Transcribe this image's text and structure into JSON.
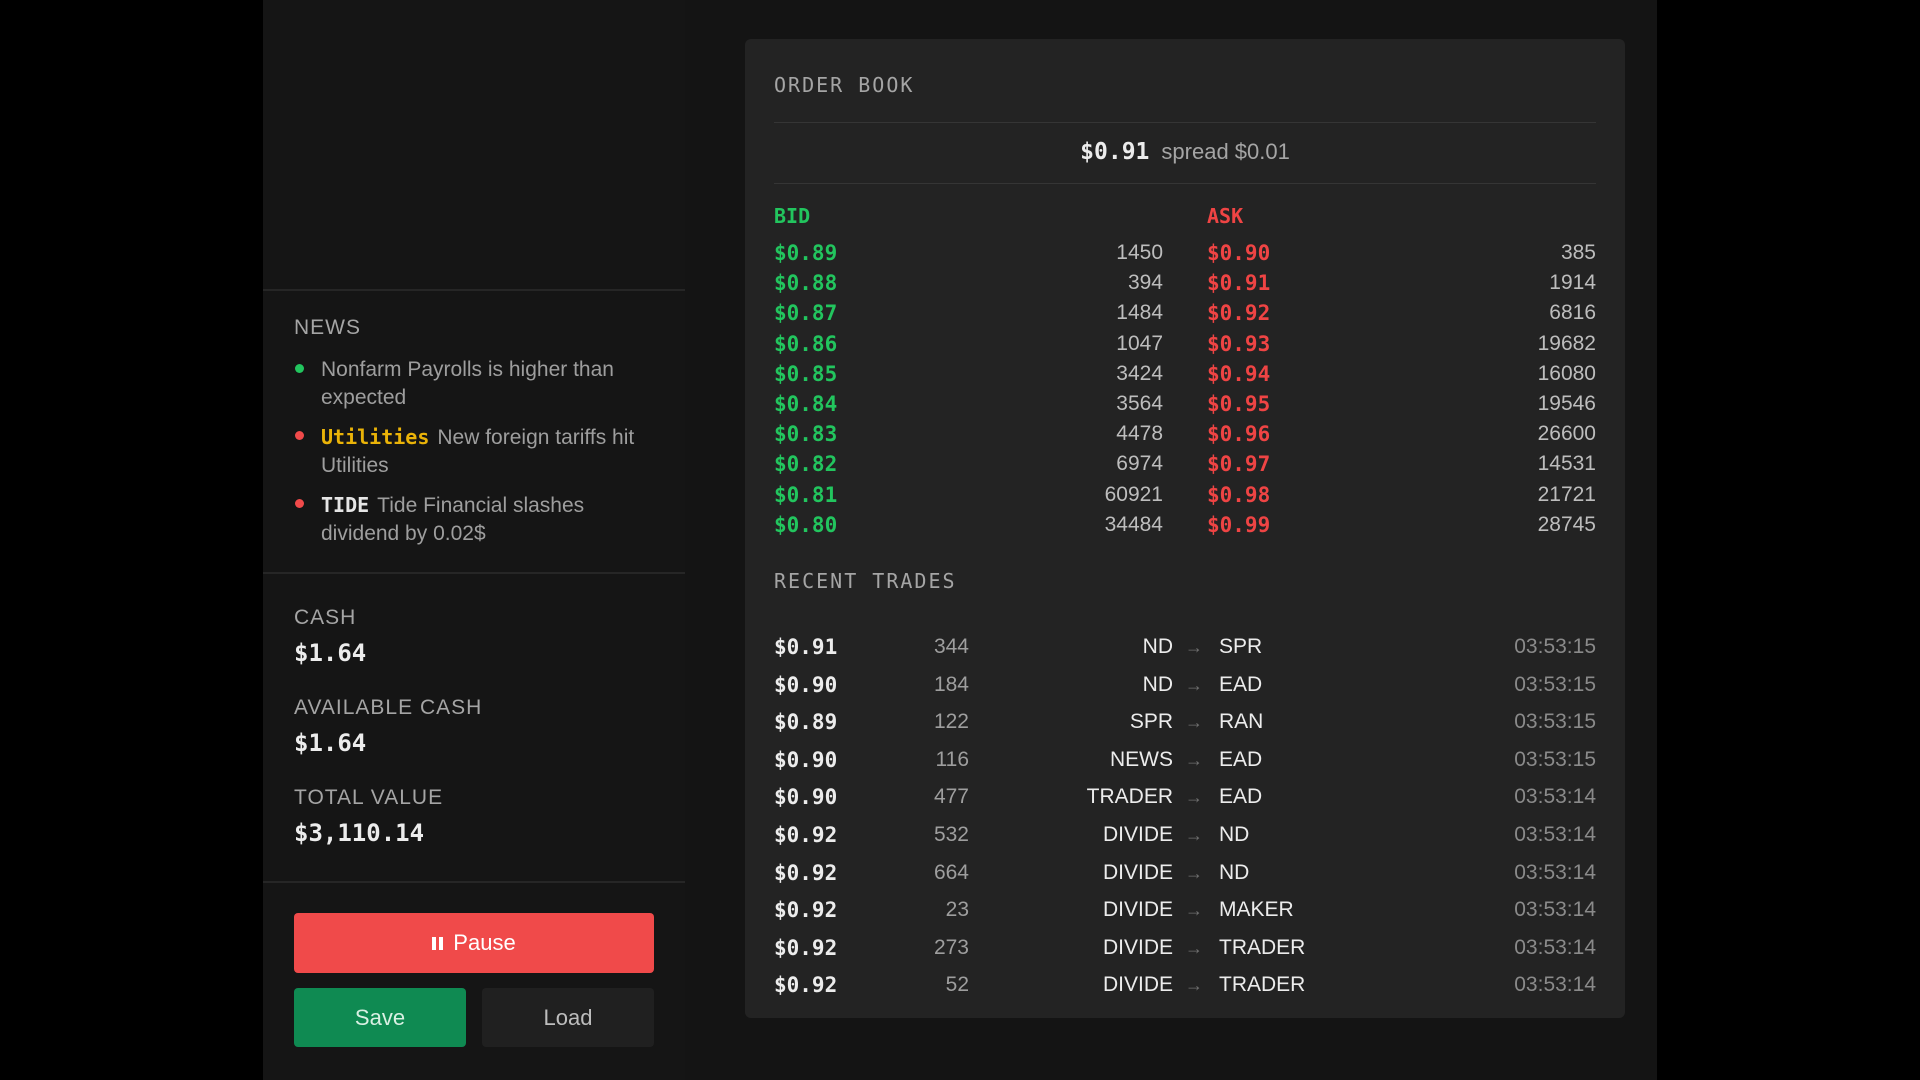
{
  "news": {
    "title": "NEWS",
    "items": [
      {
        "tag": "",
        "text": "Nonfarm Payrolls is higher than expected",
        "dot_color": "#22c55e",
        "tag_color": "#e5e5e5"
      },
      {
        "tag": "Utilities",
        "text": "New foreign tariffs hit Utilities",
        "dot_color": "#f04a4a",
        "tag_color": "#eab308"
      },
      {
        "tag": "TIDE",
        "text": "Tide Financial slashes dividend by 0.02$",
        "dot_color": "#f04a4a",
        "tag_color": "#e5e5e5"
      }
    ]
  },
  "account": {
    "cash_label": "CASH",
    "cash_value": "$1.64",
    "available_label": "AVAILABLE CASH",
    "available_value": "$1.64",
    "total_label": "TOTAL VALUE",
    "total_value": "$3,110.14"
  },
  "controls": {
    "pause_label": "Pause",
    "save_label": "Save",
    "load_label": "Load"
  },
  "order_book": {
    "title": "ORDER BOOK",
    "mid_price": "$0.91",
    "spread": "spread $0.01",
    "bid_label": "BID",
    "ask_label": "ASK",
    "bid_color": "#22c55e",
    "ask_color": "#ef4444",
    "bids": [
      {
        "price": "$0.89",
        "qty": "1450"
      },
      {
        "price": "$0.88",
        "qty": "394"
      },
      {
        "price": "$0.87",
        "qty": "1484"
      },
      {
        "price": "$0.86",
        "qty": "1047"
      },
      {
        "price": "$0.85",
        "qty": "3424"
      },
      {
        "price": "$0.84",
        "qty": "3564"
      },
      {
        "price": "$0.83",
        "qty": "4478"
      },
      {
        "price": "$0.82",
        "qty": "6974"
      },
      {
        "price": "$0.81",
        "qty": "60921"
      },
      {
        "price": "$0.80",
        "qty": "34484"
      }
    ],
    "asks": [
      {
        "price": "$0.90",
        "qty": "385"
      },
      {
        "price": "$0.91",
        "qty": "1914"
      },
      {
        "price": "$0.92",
        "qty": "6816"
      },
      {
        "price": "$0.93",
        "qty": "19682"
      },
      {
        "price": "$0.94",
        "qty": "16080"
      },
      {
        "price": "$0.95",
        "qty": "19546"
      },
      {
        "price": "$0.96",
        "qty": "26600"
      },
      {
        "price": "$0.97",
        "qty": "14531"
      },
      {
        "price": "$0.98",
        "qty": "21721"
      },
      {
        "price": "$0.99",
        "qty": "28745"
      }
    ]
  },
  "recent_trades": {
    "title": "RECENT TRADES",
    "arrow": "→",
    "rows": [
      {
        "price": "$0.91",
        "qty": "344",
        "from": "ND",
        "to": "SPR",
        "time": "03:53:15"
      },
      {
        "price": "$0.90",
        "qty": "184",
        "from": "ND",
        "to": "EAD",
        "time": "03:53:15"
      },
      {
        "price": "$0.89",
        "qty": "122",
        "from": "SPR",
        "to": "RAN",
        "time": "03:53:15"
      },
      {
        "price": "$0.90",
        "qty": "116",
        "from": "NEWS",
        "to": "EAD",
        "time": "03:53:15"
      },
      {
        "price": "$0.90",
        "qty": "477",
        "from": "TRADER",
        "to": "EAD",
        "time": "03:53:14"
      },
      {
        "price": "$0.92",
        "qty": "532",
        "from": "DIVIDE",
        "to": "ND",
        "time": "03:53:14"
      },
      {
        "price": "$0.92",
        "qty": "664",
        "from": "DIVIDE",
        "to": "ND",
        "time": "03:53:14"
      },
      {
        "price": "$0.92",
        "qty": "23",
        "from": "DIVIDE",
        "to": "MAKER",
        "time": "03:53:14"
      },
      {
        "price": "$0.92",
        "qty": "273",
        "from": "DIVIDE",
        "to": "TRADER",
        "time": "03:53:14"
      },
      {
        "price": "$0.92",
        "qty": "52",
        "from": "DIVIDE",
        "to": "TRADER",
        "time": "03:53:14"
      }
    ]
  }
}
